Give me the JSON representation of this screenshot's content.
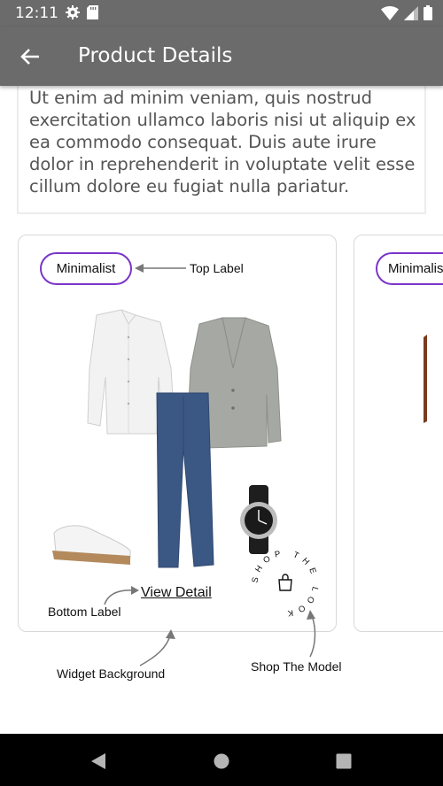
{
  "status_bar": {
    "time": "12:11",
    "icons": [
      "settings-icon",
      "sd-card-icon",
      "wifi-icon",
      "signal-icon",
      "battery-icon"
    ]
  },
  "app_bar": {
    "title": "Product Details",
    "back_icon": "arrow-left-icon"
  },
  "description": {
    "text": "Ut enim ad minim veniam, quis nostrud exercitation ullamco laboris nisi ut aliquip ex ea commodo consequat. Duis aute irure dolor in reprehenderit in voluptate velit esse cillum dolore eu fugiat nulla pariatur."
  },
  "widgets": [
    {
      "top_label": "Minimalist",
      "bottom_label": "View Detail"
    },
    {
      "top_label": "Minimalist"
    }
  ],
  "shop_the_look": {
    "text": "SHOP THE LOOK",
    "icon": "shopping-bag-icon"
  },
  "annotations": {
    "top_label": "Top Label",
    "bottom_label": "Bottom Label",
    "widget_background": "Widget Background",
    "shop_the_model": "Shop The Model"
  },
  "colors": {
    "app_bar": "#6b6b6b",
    "pill_border": "#7b35c9",
    "nav_bar": "#000000"
  }
}
